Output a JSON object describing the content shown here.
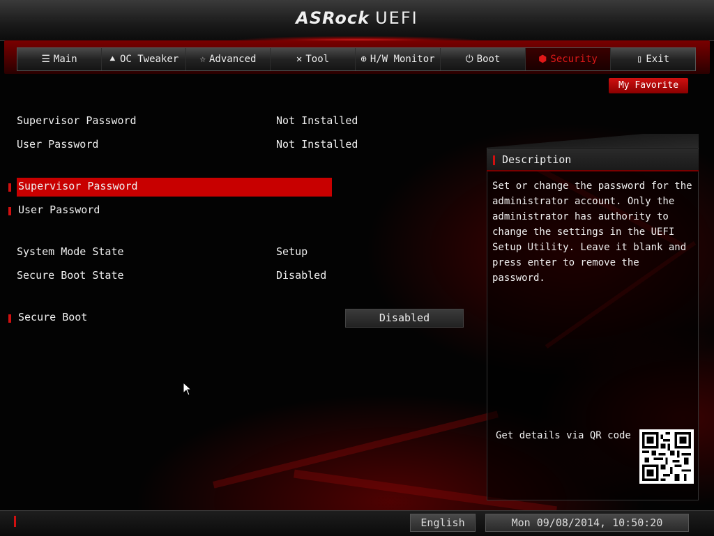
{
  "header": {
    "logo_brand": "ASRock",
    "logo_product": "UEFI"
  },
  "nav": {
    "tabs": [
      {
        "label": "Main",
        "icon": "list-icon",
        "active": false
      },
      {
        "label": "OC Tweaker",
        "icon": "rocket-icon",
        "active": false
      },
      {
        "label": "Advanced",
        "icon": "star-icon",
        "active": false
      },
      {
        "label": "Tool",
        "icon": "tools-icon",
        "active": false
      },
      {
        "label": "H/W Monitor",
        "icon": "monitor-icon",
        "active": false
      },
      {
        "label": "Boot",
        "icon": "power-icon",
        "active": false
      },
      {
        "label": "Security",
        "icon": "shield-icon",
        "active": true
      },
      {
        "label": "Exit",
        "icon": "door-icon",
        "active": false
      }
    ],
    "favorite_label": "My Favorite"
  },
  "settings": {
    "supervisor_status_label": "Supervisor Password",
    "supervisor_status_value": "Not Installed",
    "user_status_label": "User Password",
    "user_status_value": "Not Installed",
    "supervisor_password_label": "Supervisor Password",
    "user_password_label": "User Password",
    "system_mode_label": "System Mode State",
    "system_mode_value": "Setup",
    "secure_boot_state_label": "Secure Boot State",
    "secure_boot_state_value": "Disabled",
    "secure_boot_label": "Secure Boot",
    "secure_boot_value": "Disabled"
  },
  "description": {
    "title": "Description",
    "text": "Set or change the password for the administrator account. Only the administrator has authority to change the settings in the UEFI Setup Utility. Leave it blank and press enter to remove the password.",
    "qr_label": "Get details via QR code"
  },
  "footer": {
    "language": "English",
    "datetime": "Mon 09/08/2014, 10:50:20"
  },
  "colors": {
    "accent": "#c80000",
    "background": "#000000",
    "text": "#f0f0f0"
  }
}
